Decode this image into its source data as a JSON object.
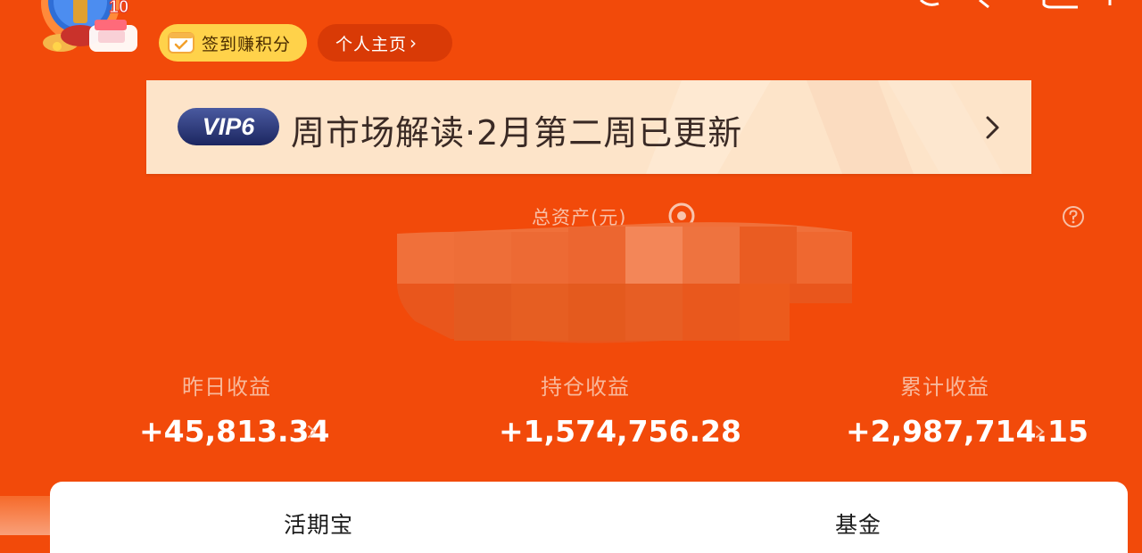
{
  "header": {
    "avatar_badge": "10",
    "checkin_label": "签到赚积分",
    "profile_label": "个人主页",
    "profile_chevron": "›"
  },
  "vip_banner": {
    "badge": "VIP6",
    "text": "周市场解读·2月第二周已更新",
    "chevron_icon": "chevron-right-icon"
  },
  "assets": {
    "label": "总资产(元)",
    "eye_icon": "eye-icon",
    "help_icon": "question-icon",
    "value_hidden": true
  },
  "stats": [
    {
      "label": "昨日收益",
      "value": "+45,813.34",
      "has_chevron": true
    },
    {
      "label": "持仓收益",
      "value": "+1,574,756.28",
      "has_chevron": false
    },
    {
      "label": "累计收益",
      "value": "+2,987,714.15",
      "has_chevron": true
    }
  ],
  "bottom_tabs": [
    "活期宝",
    "基金"
  ],
  "colors": {
    "background": "#f24a0a",
    "banner": "#fde4c9",
    "checkin_pill": "#ffd24a",
    "profile_pill": "#d93a06",
    "vip_badge": "#2a3a7a"
  }
}
